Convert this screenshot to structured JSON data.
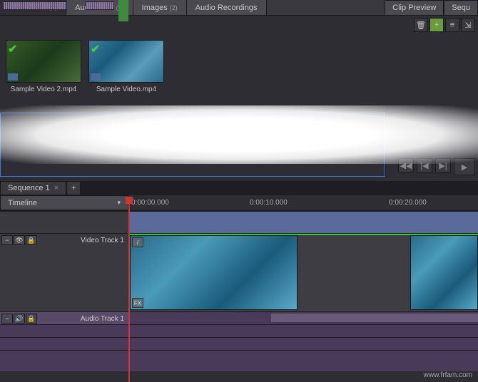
{
  "tabs": {
    "video": {
      "label": "Video Files",
      "count": "(2)"
    },
    "audio": {
      "label": "Audio Files",
      "count": "(1)"
    },
    "images": {
      "label": "Images",
      "count": "(2)"
    },
    "recordings": {
      "label": "Audio Recordings"
    },
    "clipPreview": {
      "label": "Clip Preview"
    },
    "sequencePreview": {
      "label": "Sequ"
    }
  },
  "media": [
    {
      "name": "Sample Video 2.mp4"
    },
    {
      "name": "Sample Video.mp4"
    }
  ],
  "sequence": {
    "tab": "Sequence 1",
    "timeline_label": "Timeline",
    "times": [
      "0:00:00.000",
      "0:00:10.000",
      "0:00:20.000"
    ]
  },
  "tracks": {
    "video": "Video Track 1",
    "audio": "Audio Track 1",
    "fx": "FX"
  },
  "icons": {
    "close": "×",
    "add": "+",
    "dropdown": "▾",
    "play": "▶",
    "prev": "|◀",
    "next": "▶|",
    "first": "◀◀",
    "check": "✔",
    "trash": "🗑",
    "list": "≡",
    "collapse": "⇲",
    "minus": "−",
    "eye": "👁",
    "lock": "🔒",
    "sound": "🔊",
    "slash": "/"
  },
  "watermark": "www.frfam.com"
}
